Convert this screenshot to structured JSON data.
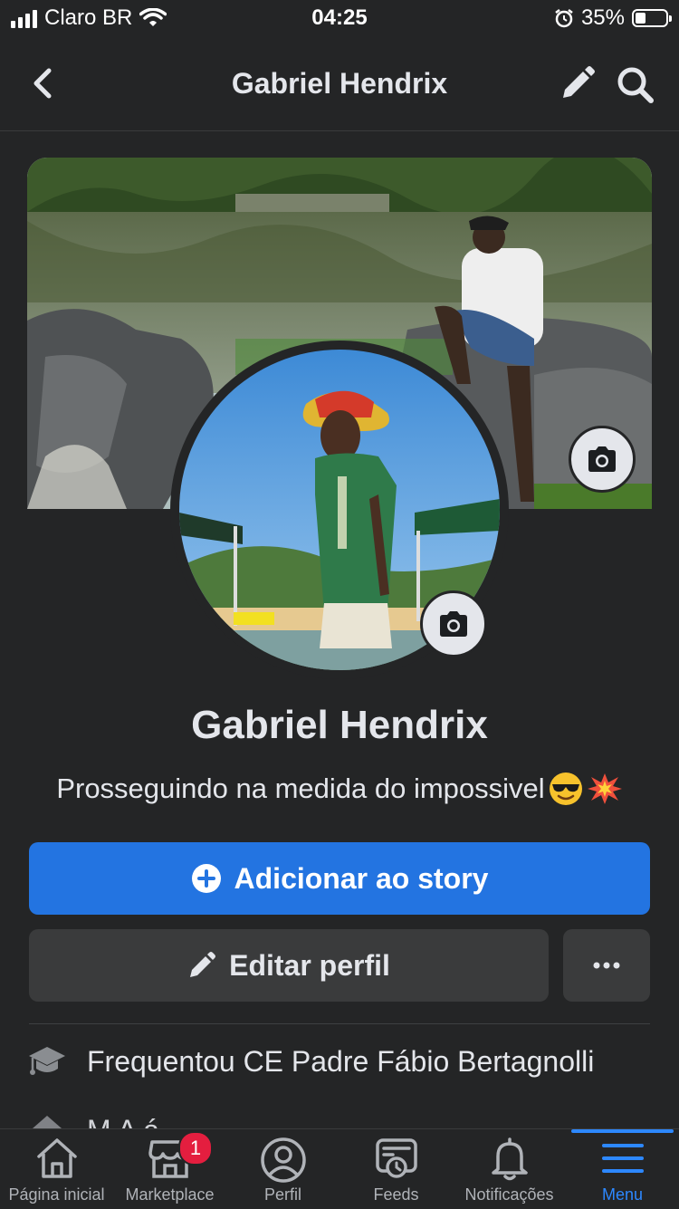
{
  "status_bar": {
    "carrier": "Claro BR",
    "time": "04:25",
    "battery": "35%",
    "battery_level": 0.35
  },
  "header": {
    "title": "Gabriel Hendrix",
    "icons": [
      "back-chevron-icon",
      "pencil-icon",
      "search-icon"
    ]
  },
  "profile": {
    "name": "Gabriel Hendrix",
    "bio": "Prosseguindo na medida do impossivel",
    "bio_emojis": [
      "sunglasses-emoji",
      "collision-emoji"
    ]
  },
  "actions": {
    "add_story": "Adicionar ao story",
    "edit_profile": "Editar perfil",
    "more_icon": "ellipsis-icon"
  },
  "intro": {
    "education": "Frequentou CE Padre Fábio Bertagnolli",
    "second_row_partial": "M  A    á"
  },
  "tabbar": {
    "tabs": [
      {
        "label": "Página inicial",
        "icon": "home-icon"
      },
      {
        "label": "Marketplace",
        "icon": "marketplace-icon",
        "badge": "1"
      },
      {
        "label": "Perfil",
        "icon": "profile-icon"
      },
      {
        "label": "Feeds",
        "icon": "feeds-icon"
      },
      {
        "label": "Notificações",
        "icon": "bell-icon"
      },
      {
        "label": "Menu",
        "icon": "menu-icon",
        "active": true
      }
    ]
  },
  "colors": {
    "background": "#242526",
    "primary": "#2374e1",
    "active_tab": "#2d88ff",
    "badge": "#e41e3f",
    "secondary_button": "#3a3b3c"
  }
}
